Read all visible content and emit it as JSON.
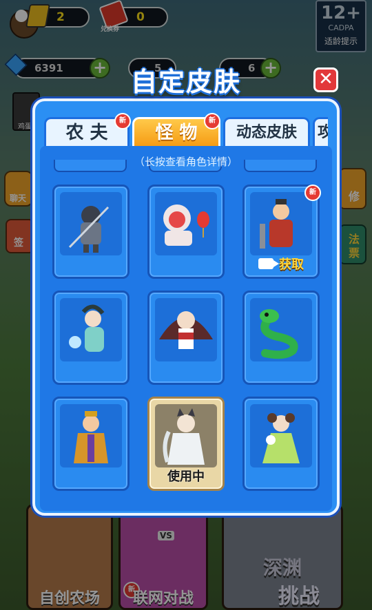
{
  "hud": {
    "energy_count": "2",
    "coupon_count": "0",
    "coupon_label": "兑换券",
    "gems": "6391",
    "resource2": "5",
    "resource3": "6",
    "age_rating": "12+",
    "age_org": "CADPA",
    "age_hint": "适龄提示"
  },
  "side": {
    "left_char_label": "鸡蛋",
    "chat_label": "聊天",
    "checkin_label": "签",
    "right1_label": "修",
    "right2_label": "法",
    "right3_label": "票"
  },
  "dialog": {
    "title": "自定皮肤",
    "tabs": [
      {
        "label": "农 夫",
        "new": "新"
      },
      {
        "label": "怪 物",
        "new": "新"
      },
      {
        "label": "动态皮肤"
      },
      {
        "label": "攻"
      }
    ],
    "hint": "（长按查看角色详情）",
    "cards": [
      {
        "name": "armored-warrior",
        "label": ""
      },
      {
        "name": "lion-dance",
        "label": ""
      },
      {
        "name": "official",
        "label": "获取",
        "new": "新",
        "video": true
      },
      {
        "name": "fairy-with-fan",
        "label": ""
      },
      {
        "name": "dancer-fans",
        "label": ""
      },
      {
        "name": "green-snake",
        "label": ""
      },
      {
        "name": "emperor",
        "label": ""
      },
      {
        "name": "white-robed-cat",
        "label": "使用中",
        "in_use": true
      },
      {
        "name": "green-dress-lady",
        "label": ""
      }
    ]
  },
  "bottom": {
    "tile1": "自创农场",
    "tile2": "联网对战",
    "tile2_badge": "新",
    "tile2_vs": "VS",
    "tile3a": "深渊",
    "tile3b": "挑战"
  },
  "colors": {
    "panel": "#2b8ff3",
    "tab_active": "#f59a12",
    "badge": "#e53a32",
    "close": "#e2383a"
  }
}
